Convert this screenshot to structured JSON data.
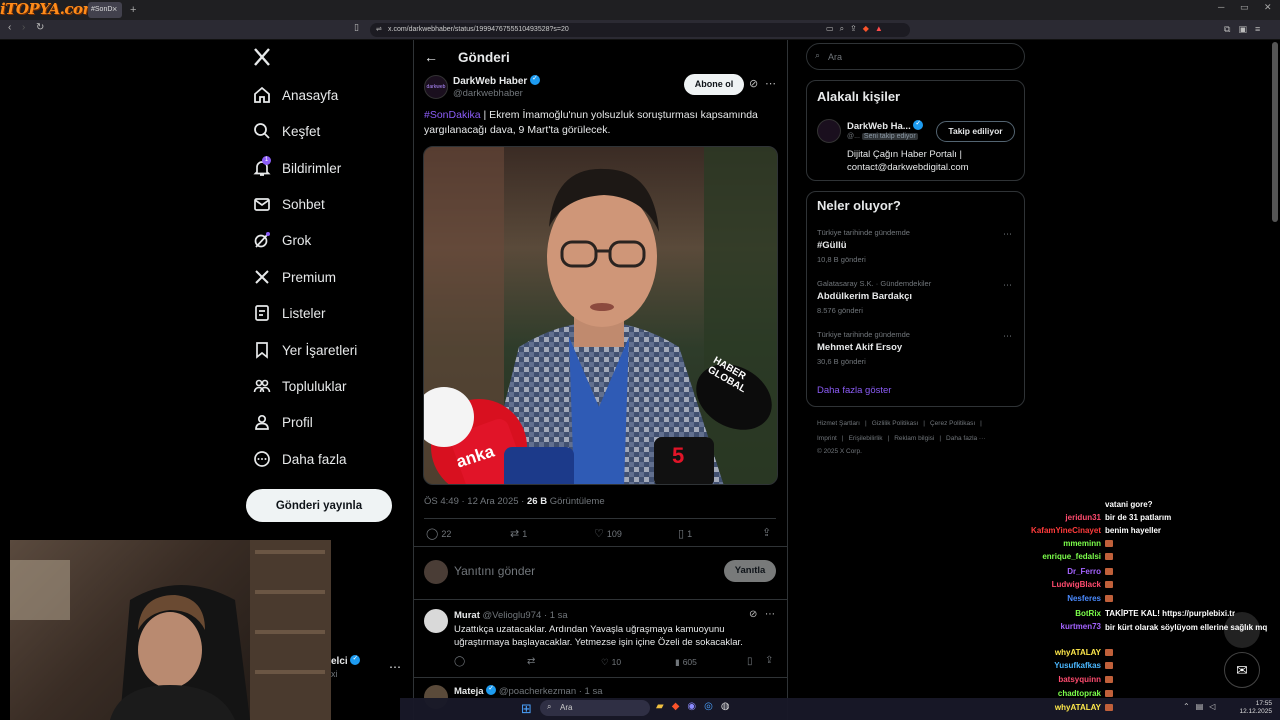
{
  "browser": {
    "watermark": "iTOPYA.com",
    "tab_title": "#SonD",
    "tab_close": "×",
    "new_tab": "+",
    "window_min": "─",
    "window_max": "▭",
    "window_close": "✕",
    "url": "x.com/darkwebhaber/status/1999476755510493528?s=20"
  },
  "nav": {
    "items": [
      {
        "label": "Anasayfa"
      },
      {
        "label": "Keşfet"
      },
      {
        "label": "Bildirimler",
        "badge": "1"
      },
      {
        "label": "Sohbet"
      },
      {
        "label": "Grok"
      },
      {
        "label": "Premium"
      },
      {
        "label": "Listeler"
      },
      {
        "label": "Yer İşaretleri"
      },
      {
        "label": "Topluluklar"
      },
      {
        "label": "Profil"
      },
      {
        "label": "Daha fazla"
      }
    ],
    "post_button": "Gönderi yayınla",
    "account_name_fragment": "elci",
    "account_handle_fragment": "xi",
    "more": "⋯"
  },
  "header": {
    "back": "←",
    "title": "Gönderi"
  },
  "tweet": {
    "author": "DarkWeb Haber",
    "handle": "@darkwebhaber",
    "avatar_text": "darkweb",
    "follow_label": "Abone ol",
    "hashtag": "#SonDakika",
    "text": " | Ekrem İmamoğlu'nun yolsuzluk soruşturması kapsamında yargılanacağı dava, 9 Mart'ta görülecek.",
    "time": "ÖS 4:49 · 12 Ara 2025 · ",
    "views_count": "26 B",
    "views_label": " Görüntüleme",
    "stats": {
      "replies": "22",
      "retweets": "1",
      "likes": "109",
      "bookmarks": "1"
    },
    "photo_labels": {
      "mic1": "anka",
      "mic2": "HABER GLOBAL",
      "mic3": "5"
    }
  },
  "reply_box": {
    "placeholder": "Yanıtını gönder",
    "button": "Yanıtla"
  },
  "replies": [
    {
      "name": "Murat",
      "handle": "@Velioglu974",
      "time": "· 1 sa",
      "text": "Uzattıkça uzatacaklar. Ardından Yavaşla uğraşmaya kamuoyunu uğraştırmaya başlayacaklar. Yetmezse işin içine Özeli de sokacaklar.",
      "stats": {
        "retweets": "",
        "likes": "10",
        "views": "605"
      }
    },
    {
      "name": "Mateja",
      "handle": "@poacherkezman",
      "time": "· 1 sa"
    }
  ],
  "right": {
    "search_placeholder": "Ara",
    "related_title": "Alakalı kişiler",
    "related": {
      "name": "DarkWeb Ha...",
      "handle": "@...",
      "follows_you": "Seni takip ediyor",
      "button": "Takip ediliyor",
      "bio": "Dijital Çağın Haber Portalı | contact@darkwebdigital.com"
    },
    "trends_title": "Neler oluyor?",
    "trends": [
      {
        "context": "Türkiye tarihinde gündemde",
        "name": "#Güllü",
        "count": "10,8 B gönderi"
      },
      {
        "context": "Galatasaray S.K. · Gündemdekiler",
        "name": "Abdülkerim Bardakçı",
        "count": "8.576 gönderi"
      },
      {
        "context": "Türkiye tarihinde gündemde",
        "name": "Mehmet Akif Ersoy",
        "count": "30,6 B gönderi"
      }
    ],
    "show_more": "Daha fazla göster",
    "footer_line1": [
      "Hizmet Şartları",
      "Gizlilik Politikası",
      "Çerez Politikası"
    ],
    "footer_line2": [
      "Imprint",
      "Erişilebilirlik",
      "Reklam bilgisi",
      "Daha fazla ···"
    ],
    "copyright": "© 2025 X Corp."
  },
  "chat": [
    {
      "name": "",
      "text": "vatani gore?",
      "color": "#ff4b4b"
    },
    {
      "name": "jeridun31",
      "text": "bir de 31 patlarım",
      "color": "#ff4b6e"
    },
    {
      "name": "KafamYineCinayet",
      "text": "benim hayeller",
      "color": "#ff3b3b"
    },
    {
      "name": "mmeminn",
      "text": "",
      "color": "#7cff4b"
    },
    {
      "name": "enrique_fedalsi",
      "text": "",
      "color": "#7cff4b"
    },
    {
      "name": "Dr_Ferro",
      "text": "",
      "color": "#a463ff"
    },
    {
      "name": "LudwigBlack",
      "text": "",
      "color": "#ff4b6e"
    },
    {
      "name": "Nesferes",
      "text": "",
      "color": "#4b8bff"
    },
    {
      "name": "BotRix",
      "text": "TAKİPTE KAL! https://purplebixi.tr",
      "color": "#7cff4b"
    },
    {
      "name": "kurtmen73",
      "text": "bir kürt olarak söylüyom ellerine sağlık mq",
      "color": "#a463ff"
    },
    {
      "name": "whyATALAY",
      "text": "",
      "color": "#ffe94b"
    },
    {
      "name": "Yusufkafkas",
      "text": "",
      "color": "#4bb8ff"
    },
    {
      "name": "batsyquinn",
      "text": "",
      "color": "#ff4b6e"
    },
    {
      "name": "chadtoprak",
      "text": "",
      "color": "#7cff4b"
    },
    {
      "name": "whyATALAY",
      "text": "",
      "color": "#ffe94b"
    }
  ],
  "taskbar": {
    "search": "Ara",
    "time": "17:55",
    "date": "12.12.2025"
  }
}
